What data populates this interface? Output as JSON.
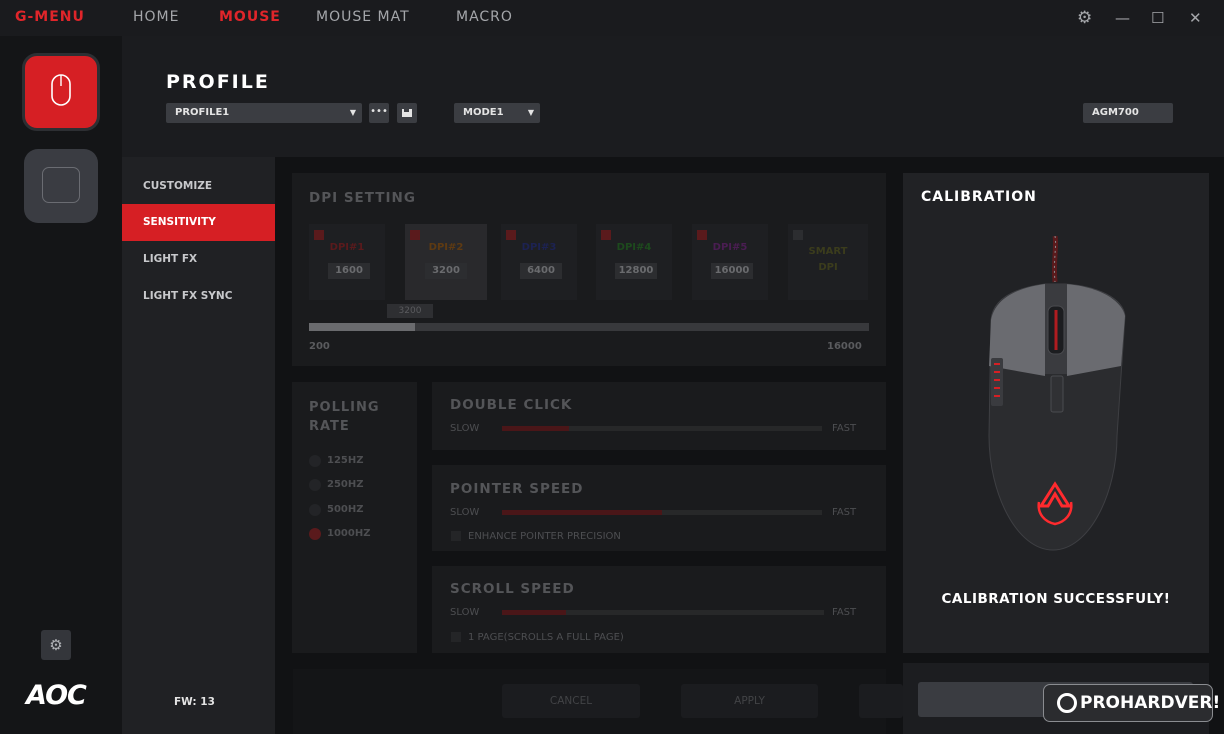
{
  "app": {
    "title": "G-MENU"
  },
  "nav": {
    "home": "HOME",
    "mouse": "MOUSE",
    "mouse_mat": "MOUSE MAT",
    "macro": "MACRO"
  },
  "window": {
    "settings_icon": "gear-icon",
    "minimize": "—",
    "maximize": "☐",
    "close": "✕"
  },
  "profile": {
    "title": "PROFILE",
    "selected_profile": "PROFILE1",
    "more_label": "•••",
    "selected_mode": "MODE1",
    "device_model": "AGM700"
  },
  "submenu": {
    "items": [
      "CUSTOMIZE",
      "SENSITIVITY",
      "LIGHT FX",
      "LIGHT FX SYNC"
    ],
    "active": "SENSITIVITY"
  },
  "firmware": "FW: 13",
  "brand_logo": "AOC",
  "dpi": {
    "title": "DPI SETTING",
    "levels": [
      {
        "label": "DPI#1",
        "value": "1600",
        "color": "#5a1a1c"
      },
      {
        "label": "DPI#2",
        "value": "3200",
        "color": "#5e3a12"
      },
      {
        "label": "DPI#3",
        "value": "6400",
        "color": "#1c2252"
      },
      {
        "label": "DPI#4",
        "value": "12800",
        "color": "#1d4a1d"
      },
      {
        "label": "DPI#5",
        "value": "16000",
        "color": "#4a1d52"
      }
    ],
    "smart": "SMART DPI",
    "slider_min": "200",
    "slider_max": "16000",
    "slider_value": "3200",
    "slider_fraction": 0.19
  },
  "polling": {
    "title": "POLLING RATE",
    "options": [
      "125HZ",
      "250HZ",
      "500HZ",
      "1000HZ"
    ],
    "selected": "1000HZ"
  },
  "double_click": {
    "title": "DOUBLE CLICK",
    "slow": "SLOW",
    "fast": "FAST",
    "value_fraction": 0.21
  },
  "pointer_speed": {
    "title": "POINTER SPEED",
    "slow": "SLOW",
    "fast": "FAST",
    "value_fraction": 0.5,
    "option": "ENHANCE POINTER PRECISION"
  },
  "scroll_speed": {
    "title": "SCROLL SPEED",
    "slow": "SLOW",
    "fast": "FAST",
    "value_fraction": 0.2,
    "option": "1 PAGE(SCROLLS A FULL PAGE)"
  },
  "buttons": {
    "cancel": "CANCEL",
    "apply": "APPLY"
  },
  "calibration": {
    "title": "CALIBRATION",
    "message": "CALIBRATION SUCCESSFULY!"
  },
  "watermark": "PROHARDVER!",
  "colors": {
    "accent": "#e0252a",
    "active_bg": "#d61f24"
  }
}
